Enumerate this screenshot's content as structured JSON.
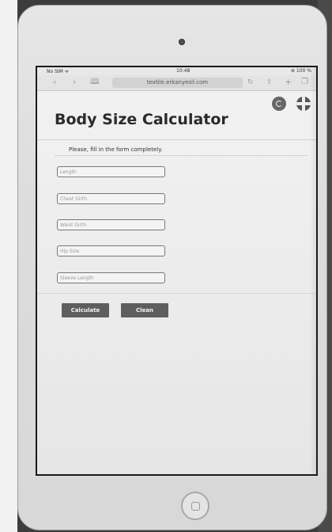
{
  "status_bar": {
    "carrier": "No SIM ᯤ",
    "time": "10:48",
    "battery": "⊛ 100 %"
  },
  "browser": {
    "url": "textile.erkanyesil.com",
    "back_icon": "chevron-left-icon",
    "forward_icon": "chevron-right-icon",
    "bookmarks_icon": "book-icon",
    "reload_icon": "reload-icon",
    "share_icon": "share-icon",
    "new_tab_icon": "plus-icon",
    "tabs_icon": "tabs-icon"
  },
  "languages": {
    "turkish_icon": "turkey-flag-icon",
    "english_icon": "uk-flag-icon"
  },
  "page": {
    "title": "Body Size Calculator",
    "instruction": "Please, fill in the form completely."
  },
  "form": {
    "fields": [
      {
        "placeholder": "Length",
        "value": ""
      },
      {
        "placeholder": "Chest Girth",
        "value": ""
      },
      {
        "placeholder": "Waist Girth",
        "value": ""
      },
      {
        "placeholder": "Hip Size",
        "value": ""
      },
      {
        "placeholder": "Sleeve Length",
        "value": ""
      }
    ],
    "calculate_label": "Calculate",
    "clean_label": "Clean"
  },
  "colors": {
    "button_bg": "#5e5e5e",
    "screen_bg": "#eeeeee",
    "title_text": "#2a2a2a"
  }
}
